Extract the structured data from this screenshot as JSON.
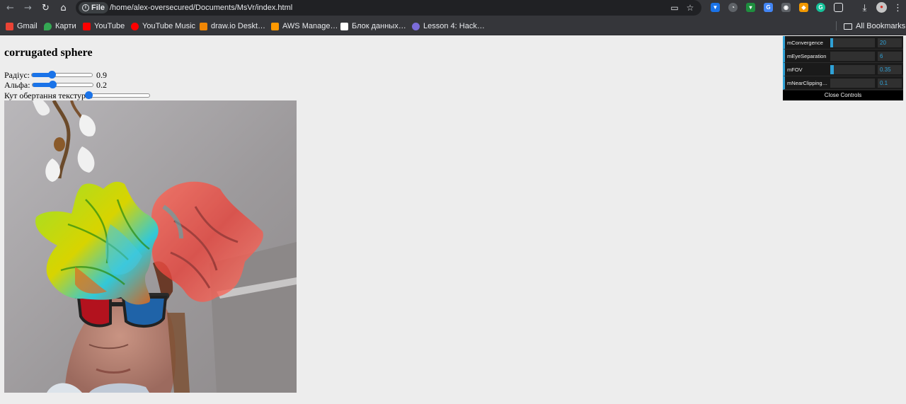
{
  "browser": {
    "url_scheme": "File",
    "url": "/home/alex-oversecured/Documents/MsVr/index.html",
    "bookmarks": [
      {
        "label": "Gmail",
        "color": "#ea4335"
      },
      {
        "label": "Карти",
        "color": "#34a853"
      },
      {
        "label": "YouTube",
        "color": "#ff0000"
      },
      {
        "label": "YouTube Music",
        "color": "#ff0000"
      },
      {
        "label": "draw.io Deskt…",
        "color": "#f08705"
      },
      {
        "label": "AWS Manage…",
        "color": "#ff9900"
      },
      {
        "label": "Блок данных…",
        "color": "#ffffff"
      },
      {
        "label": "Lesson 4: Hack…",
        "color": "#7b6cd9"
      }
    ],
    "all_bookmarks_label": "All Bookmarks"
  },
  "page": {
    "title": "corrugated sphere",
    "controls": [
      {
        "label": "Радіус:",
        "value": "0.9",
        "level": 0.33
      },
      {
        "label": "Альфа:",
        "value": "0.2",
        "level": 0.33
      },
      {
        "label": "Кут обертання текстури:",
        "value": "",
        "level": 0.0
      }
    ]
  },
  "gui": {
    "params": [
      {
        "name": "mConvergence",
        "value": "20",
        "level": 0.06
      },
      {
        "name": "mEyeSeparation",
        "value": "6",
        "level": 0.0
      },
      {
        "name": "mFOV",
        "value": "0.35",
        "level": 0.08
      },
      {
        "name": "mNearClippingD…",
        "value": "0.1",
        "level": 0.0
      }
    ],
    "close_label": "Close Controls",
    "accent_color": "#2fa1d6"
  }
}
